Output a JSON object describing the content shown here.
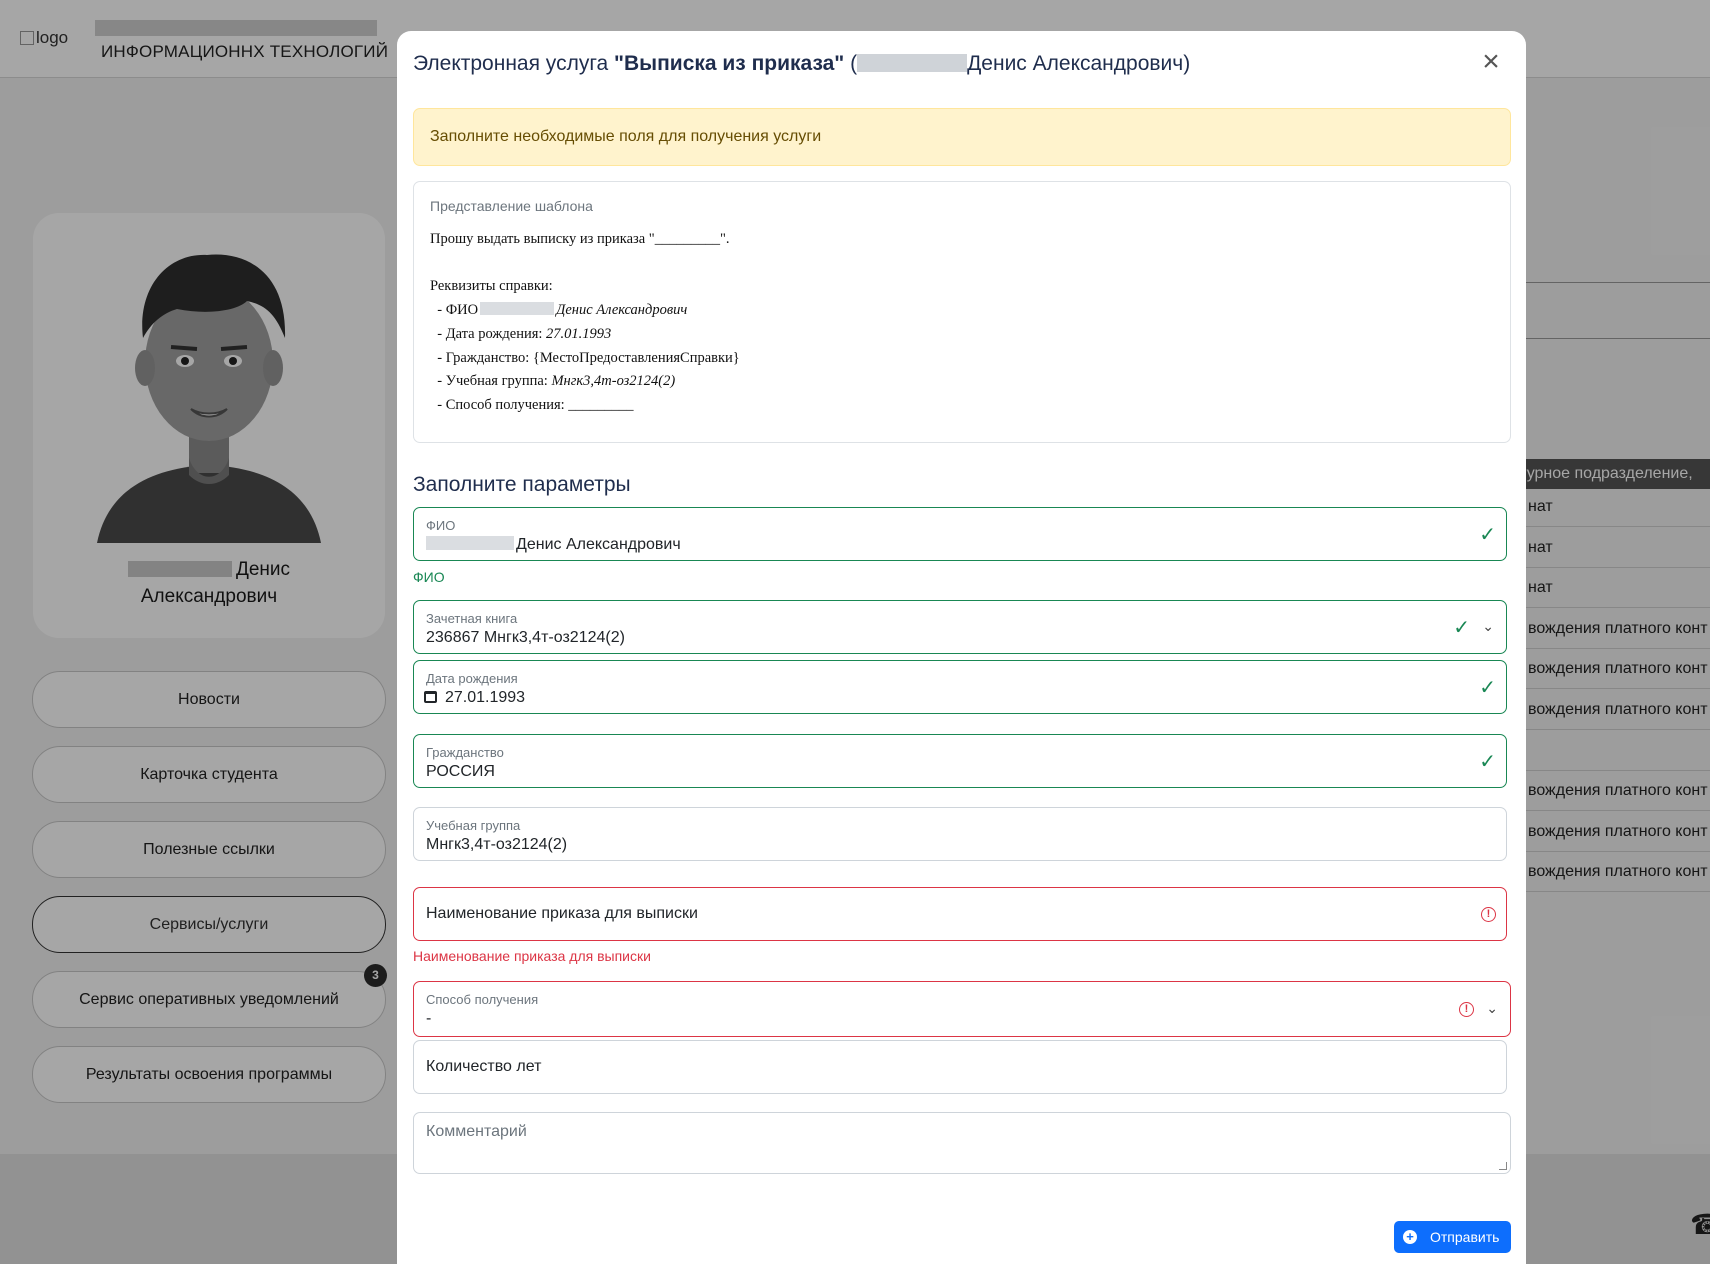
{
  "header": {
    "logo_alt": "logo",
    "org_name": "ИНФОРМАЦИОННХ ТЕХНОЛОГИЙ"
  },
  "profile": {
    "first_name": "Денис",
    "patronymic": "Александрович"
  },
  "sidebar": {
    "items": [
      {
        "label": "Новости"
      },
      {
        "label": "Карточка студента"
      },
      {
        "label": "Полезные ссылки"
      },
      {
        "label": "Сервисы/услуги"
      },
      {
        "label": "Сервис оперативных уведомлений",
        "badge": "3"
      },
      {
        "label": "Результаты освоения программы"
      }
    ]
  },
  "background_table": {
    "header": "ктурное подразделение,",
    "rows": [
      "нат",
      "нат",
      "нат",
      "вождения платного конт",
      "вождения платного конт",
      "вождения платного конт",
      "",
      "вождения платного конт",
      "вождения платного конт",
      "вождения платного конт"
    ]
  },
  "modal": {
    "title_prefix": "Электронная услуга ",
    "title_service": "\"Выписка из приказа\"",
    "title_open": " (",
    "title_name": "Денис Александрович)",
    "close_glyph": "×",
    "alert": "Заполните необходимые поля для получения услуги",
    "template": {
      "label": "Представление шаблона",
      "line1": "Прошу выдать выписку из приказа \"_________\".",
      "line2": "Реквизиты справки:",
      "fio_label": "  - ФИО",
      "fio_value": "Денис Александрович",
      "birth_label": "  - Дата рождения: ",
      "birth_value": "27.01.1993",
      "citizenship_line": "  - Гражданство: {МестоПредоставленияСправки}",
      "group_label": "  - Учебная группа: ",
      "group_value": "Мнгк3,4т-оз2124(2)",
      "method_line": "  - Способ получения: _________"
    },
    "section_title": "Заполните параметры",
    "fields": {
      "fio": {
        "label": "ФИО",
        "value": "Денис Александрович",
        "feedback": "ФИО"
      },
      "record_book": {
        "label": "Зачетная книга",
        "value": "236867 Мнгк3,4т-оз2124(2)"
      },
      "birth_date": {
        "label": "Дата рождения",
        "value": "27.01.1993"
      },
      "citizenship": {
        "label": "Гражданство",
        "value": "РОССИЯ"
      },
      "study_group": {
        "label": "Учебная группа",
        "value": "Мнгк3,4т-оз2124(2)"
      },
      "order_name": {
        "placeholder": "Наименование приказа для выписки",
        "feedback": "Наименование приказа для выписки"
      },
      "receipt_method": {
        "label": "Способ получения",
        "value": "-"
      },
      "years_count": {
        "placeholder": "Количество лет"
      },
      "comment": {
        "placeholder": "Комментарий"
      }
    },
    "submit_label": "Отправить"
  },
  "colors": {
    "valid": "#198754",
    "invalid": "#dc3545",
    "primary": "#0d6efd",
    "alert_bg": "#fff3cd",
    "title": "#1f2d4d"
  },
  "icons": [
    "close-icon",
    "check-icon",
    "chevron-down-icon",
    "calendar-icon",
    "error-icon",
    "plus-circle-icon",
    "phone-icon"
  ]
}
